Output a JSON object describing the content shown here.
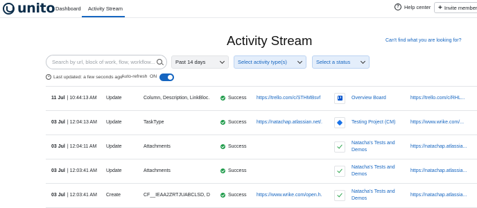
{
  "header": {
    "logo_text": "unito",
    "nav": {
      "dashboard": "Dashboard",
      "activity_stream": "Activity Stream"
    },
    "help_label": "Help center",
    "invite_label": "Invite members"
  },
  "page": {
    "title": "Activity Stream",
    "cant_find_link": "Can't find what you are looking for?"
  },
  "filters": {
    "search_placeholder": "Search by url, block of work, flow, workflow...",
    "date_range": "Past 14 days",
    "activity_type": "Select activity type(s)",
    "status": "Select a status"
  },
  "refresh": {
    "last_updated": "Last updated: a few seconds ago",
    "auto_refresh_label": "Auto-refresh",
    "toggle_state": "ON"
  },
  "rows": [
    {
      "date": "11 Jul",
      "time": "| 10:44:13 AM",
      "action": "Update",
      "fields": "Column, Description, LinkBloc...",
      "status": "Success",
      "source_url": "https://trello.com/c/STHMBsvf",
      "app_icon": "trello-icon",
      "destination": "Overview Board",
      "dest_url": "https://trello.com/c/RHL..."
    },
    {
      "date": "03 Jul",
      "time": "| 12:04:13 AM",
      "action": "Update",
      "fields": "TaskType",
      "status": "Success",
      "source_url": "https://natachap.atlassian.net/...",
      "app_icon": "wrike-icon",
      "destination": "Testing Project (CM)",
      "dest_url": "https://www.wrike.com/..."
    },
    {
      "date": "03 Jul",
      "time": "| 12:04:11 AM",
      "action": "Update",
      "fields": "Attachments",
      "status": "Success",
      "source_url": "",
      "app_icon": "check-icon",
      "destination": "Natacha's Tests and Demos",
      "dest_url": "https://natachap.atlassia..."
    },
    {
      "date": "03 Jul",
      "time": "| 12:03:41 AM",
      "action": "Update",
      "fields": "Attachments",
      "status": "Success",
      "source_url": "",
      "app_icon": "check-icon",
      "destination": "Natacha's Tests and Demos",
      "dest_url": "https://natachap.atlassia..."
    },
    {
      "date": "03 Jul",
      "time": "| 12:03:41 AM",
      "action": "Create",
      "fields": "CF__IEAA2ZRTJUABCLSD, De...",
      "status": "Success",
      "source_url": "https://www.wrike.com/open.h...",
      "app_icon": "check-icon",
      "destination": "Natacha's Tests and Demos",
      "dest_url": "https://natachap.atlassia..."
    }
  ],
  "colors": {
    "accent": "#1565c0",
    "success": "#1e9b4a",
    "brand": "#0b2d4a"
  }
}
